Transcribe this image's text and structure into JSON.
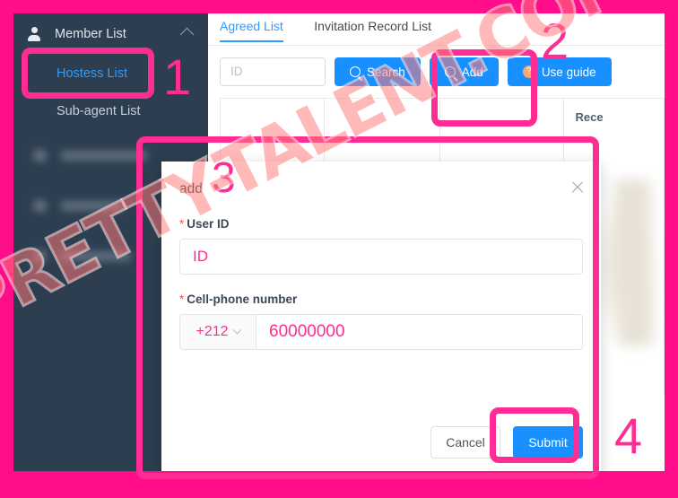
{
  "frame": {
    "accent_pink": "#ff2d93",
    "frame_pink": "#ff0d8a",
    "brand_blue": "#1890ff",
    "sidebar_bg": "#2d3e50"
  },
  "sidebar": {
    "group": {
      "label": "Member List",
      "icon": "person-icon",
      "collapse_icon": "chevron-up-icon"
    },
    "items": [
      {
        "label": "Hostess List",
        "active": true
      },
      {
        "label": "Sub-agent List",
        "active": false
      }
    ]
  },
  "content": {
    "tabs": [
      {
        "label": "Agreed List",
        "active": true
      },
      {
        "label": "Invitation Record List",
        "active": false
      }
    ],
    "toolbar": {
      "id_placeholder": "ID",
      "search_label": "Search",
      "add_label": "Add",
      "use_guide_label": "Use guide",
      "search_icon": "magnifier-icon",
      "add_icon": "magnifier-icon",
      "guide_icon": "question-mark-icon"
    },
    "table": {
      "headers": [
        "",
        "",
        "",
        "Rece"
      ]
    }
  },
  "modal": {
    "title": "add",
    "close_icon": "close-icon",
    "fields": {
      "user_id": {
        "label": "User ID",
        "required_mark": "*",
        "value": "ID"
      },
      "phone": {
        "label": "Cell-phone number",
        "required_mark": "*",
        "country_code": "+212",
        "country_code_icon": "chevron-down-icon",
        "value": "60000000"
      }
    },
    "buttons": {
      "cancel": "Cancel",
      "submit": "Submit"
    }
  },
  "annotations": {
    "step1": "1",
    "step2": "2",
    "step3": "3",
    "step4": "4"
  },
  "watermark": {
    "text": "PRETTY-TALENT.COM"
  }
}
